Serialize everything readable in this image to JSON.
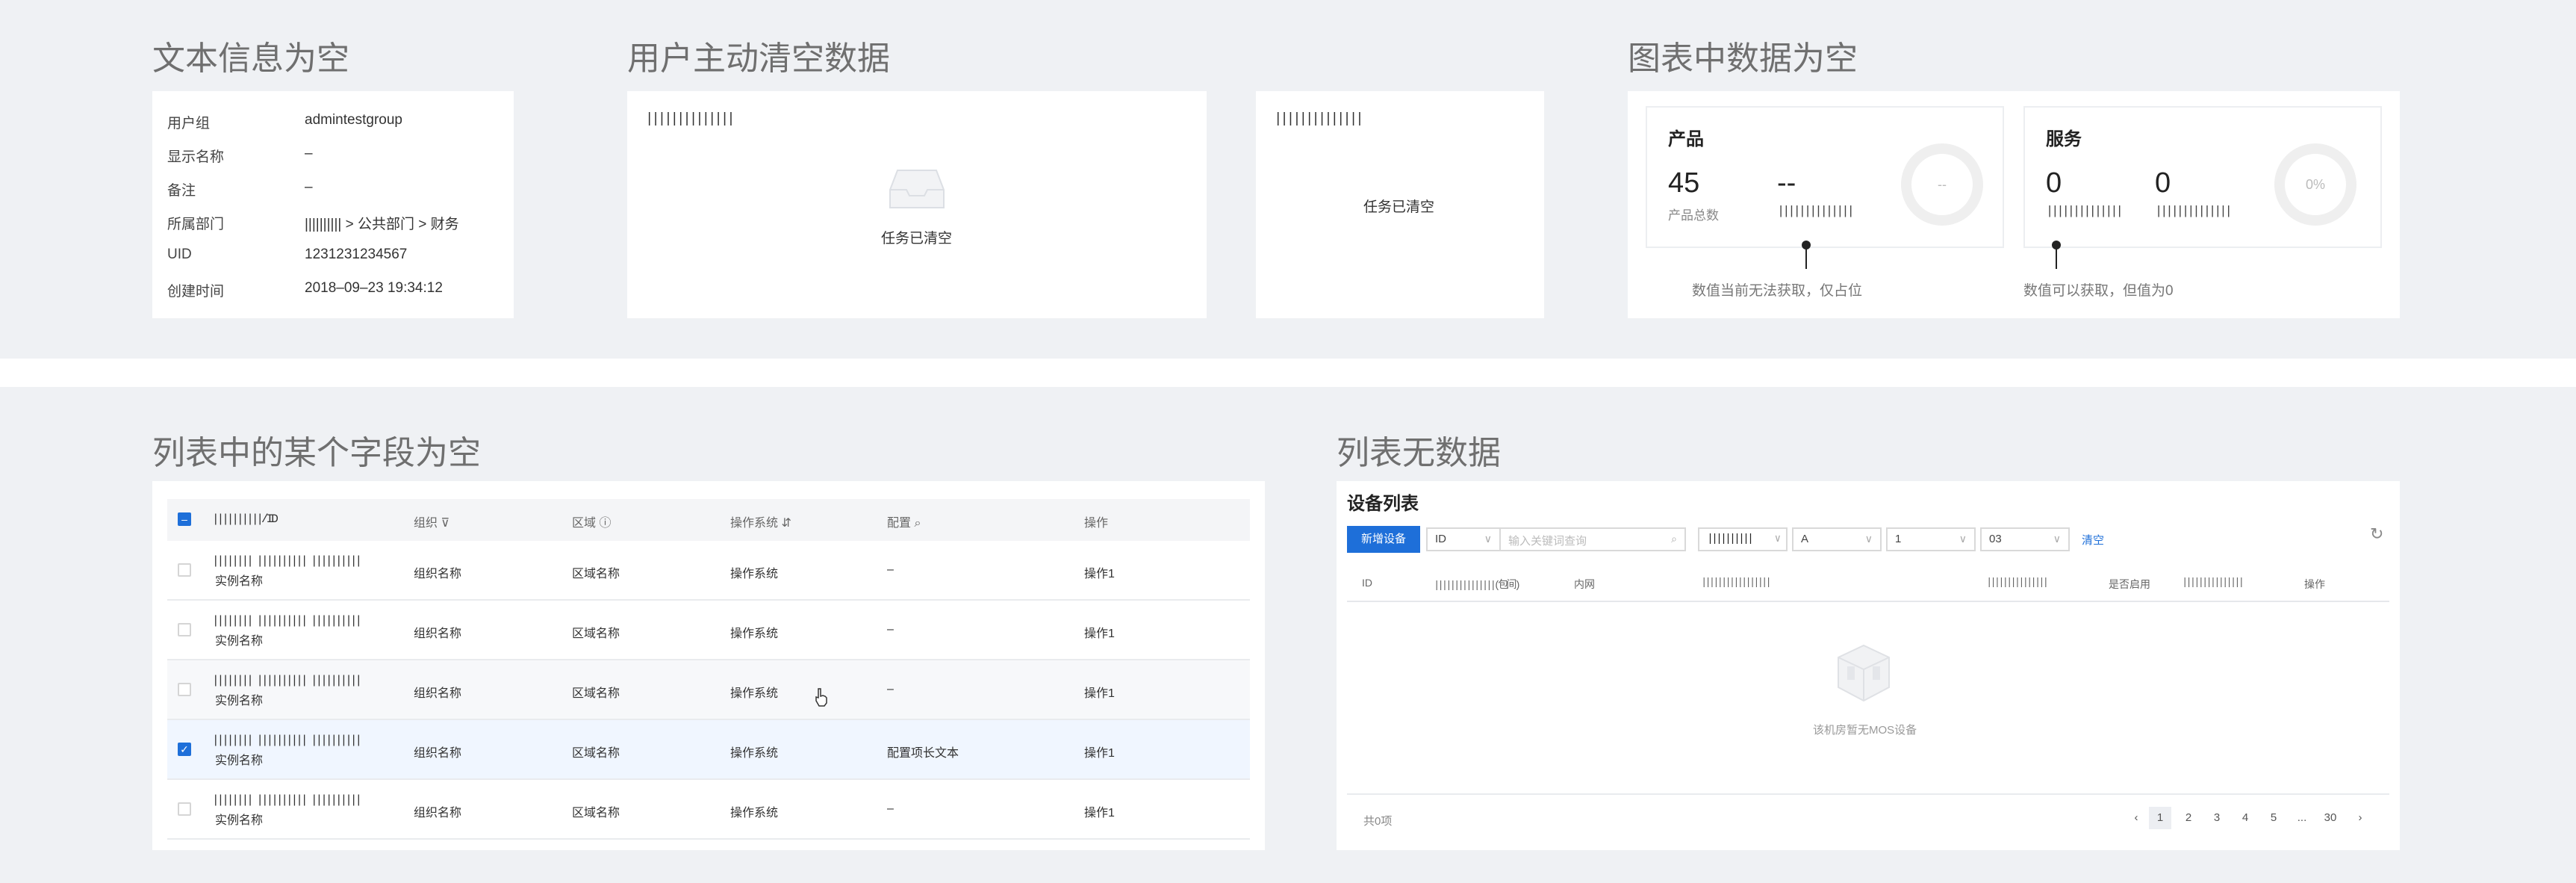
{
  "section_titles": {
    "text_empty": "文本信息为空",
    "user_cleared": "用户主动清空数据",
    "chart_empty": "图表中数据为空",
    "list_field_empty": "列表中的某个字段为空",
    "list_no_data": "列表无数据"
  },
  "info_card": {
    "rows": [
      {
        "label": "用户组",
        "value": "admintestgroup"
      },
      {
        "label": "显示名称",
        "value": "–"
      },
      {
        "label": "备注",
        "value": "–"
      },
      {
        "label": "所属部门",
        "value": "|||||||||| > 公共部门 > 财务"
      },
      {
        "label": "UID",
        "value": "1231231234567"
      },
      {
        "label": "创建时间",
        "value": "2018–09–23 19:34:12"
      }
    ]
  },
  "cleared_cards": [
    {
      "title": "||||||||||||||",
      "message": "任务已清空"
    },
    {
      "title": "||||||||||||||",
      "message": "任务已清空"
    }
  ],
  "chart_cards": {
    "product": {
      "title": "产品",
      "value1": "45",
      "label1": "产品总数",
      "value2": "--",
      "label2": "||||||||||||||",
      "donut": "--",
      "note": "数值当前无法获取，仅占位"
    },
    "service": {
      "title": "服务",
      "value1": "0",
      "label1": "||||||||||||||",
      "value2": "0",
      "label2": "||||||||||||||",
      "donut": "0%",
      "note": "数值可以获取，但值为0"
    }
  },
  "list_table": {
    "headers": {
      "name": "||||||||||/ID",
      "org": "组织",
      "region": "区域",
      "os": "操作系统",
      "config": "配置",
      "action": "操作"
    },
    "rows": [
      {
        "name": "|||||||| |||||||||| ||||||||||",
        "sub": "实例名称",
        "org": "组织名称",
        "region": "区域名称",
        "os": "操作系统",
        "config": "–",
        "action": "操作1",
        "checked": false
      },
      {
        "name": "|||||||| |||||||||| ||||||||||",
        "sub": "实例名称",
        "org": "组织名称",
        "region": "区域名称",
        "os": "操作系统",
        "config": "–",
        "action": "操作1",
        "checked": false
      },
      {
        "name": "|||||||| |||||||||| ||||||||||",
        "sub": "实例名称",
        "org": "组织名称",
        "region": "区域名称",
        "os": "操作系统",
        "config": "–",
        "action": "操作1",
        "checked": false
      },
      {
        "name": "|||||||| |||||||||| ||||||||||",
        "sub": "实例名称",
        "org": "组织名称",
        "region": "区域名称",
        "os": "操作系统",
        "config": "配置项长文本",
        "action": "操作1",
        "checked": true
      },
      {
        "name": "|||||||| |||||||||| ||||||||||",
        "sub": "实例名称",
        "org": "组织名称",
        "region": "区域名称",
        "os": "操作系统",
        "config": "–",
        "action": "操作1",
        "checked": false
      }
    ]
  },
  "device_list": {
    "title": "设备列表",
    "add_button": "新增设备",
    "filter_field": "ID",
    "search_placeholder": "输入关键词查询",
    "filter_a": "||||||||||",
    "filter_b": "A",
    "filter_c": "1",
    "filter_d": "03",
    "clear_link": "清空",
    "headers": [
      "ID",
      "|||||||||||||||(包间)",
      "内网",
      "|||||||||||||||||",
      "|||||||||||||||",
      "是否启用",
      "|||||||||||||||",
      "操作"
    ],
    "empty_message": "该机房暂无MOS设备",
    "total": "共0项",
    "pages": [
      "1",
      "2",
      "3",
      "4",
      "5",
      "...",
      "30"
    ]
  },
  "colors": {
    "band": "#eff1f4",
    "accent": "#1e6fd9"
  }
}
